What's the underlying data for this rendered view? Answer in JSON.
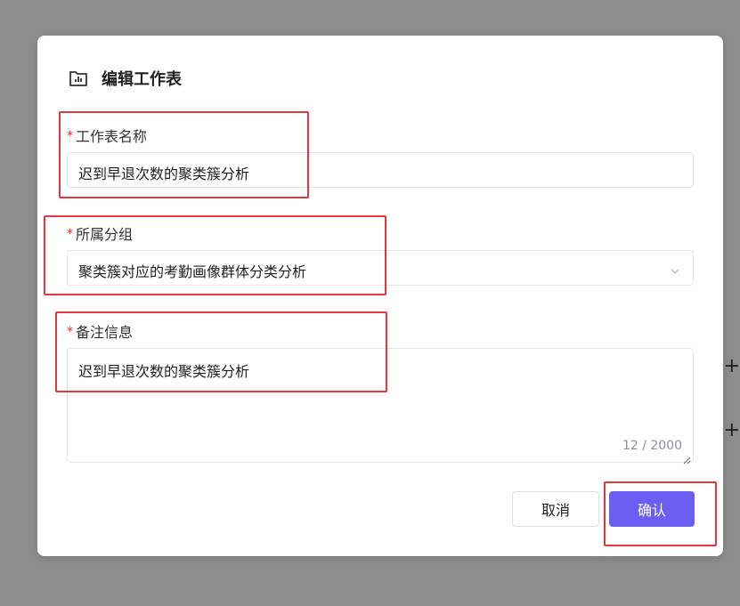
{
  "dialog": {
    "title": "编辑工作表",
    "title_icon": "chart-folder-icon"
  },
  "fields": {
    "name": {
      "required_mark": "*",
      "label": "工作表名称",
      "value": "迟到早退次数的聚类簇分析"
    },
    "group": {
      "required_mark": "*",
      "label": "所属分组",
      "value": "聚类簇对应的考勤画像群体分类分析"
    },
    "remark": {
      "required_mark": "*",
      "label": "备注信息",
      "value": "迟到早退次数的聚类簇分析",
      "counter": "12 / 2000"
    }
  },
  "actions": {
    "cancel_label": "取消",
    "confirm_label": "确认"
  },
  "side_controls": {
    "plus_1": "+",
    "plus_2": "+"
  },
  "colors": {
    "primary": "#6b5ef0",
    "highlight": "#e8353b",
    "required": "#f5222d",
    "backdrop": "#8d8d8d"
  }
}
